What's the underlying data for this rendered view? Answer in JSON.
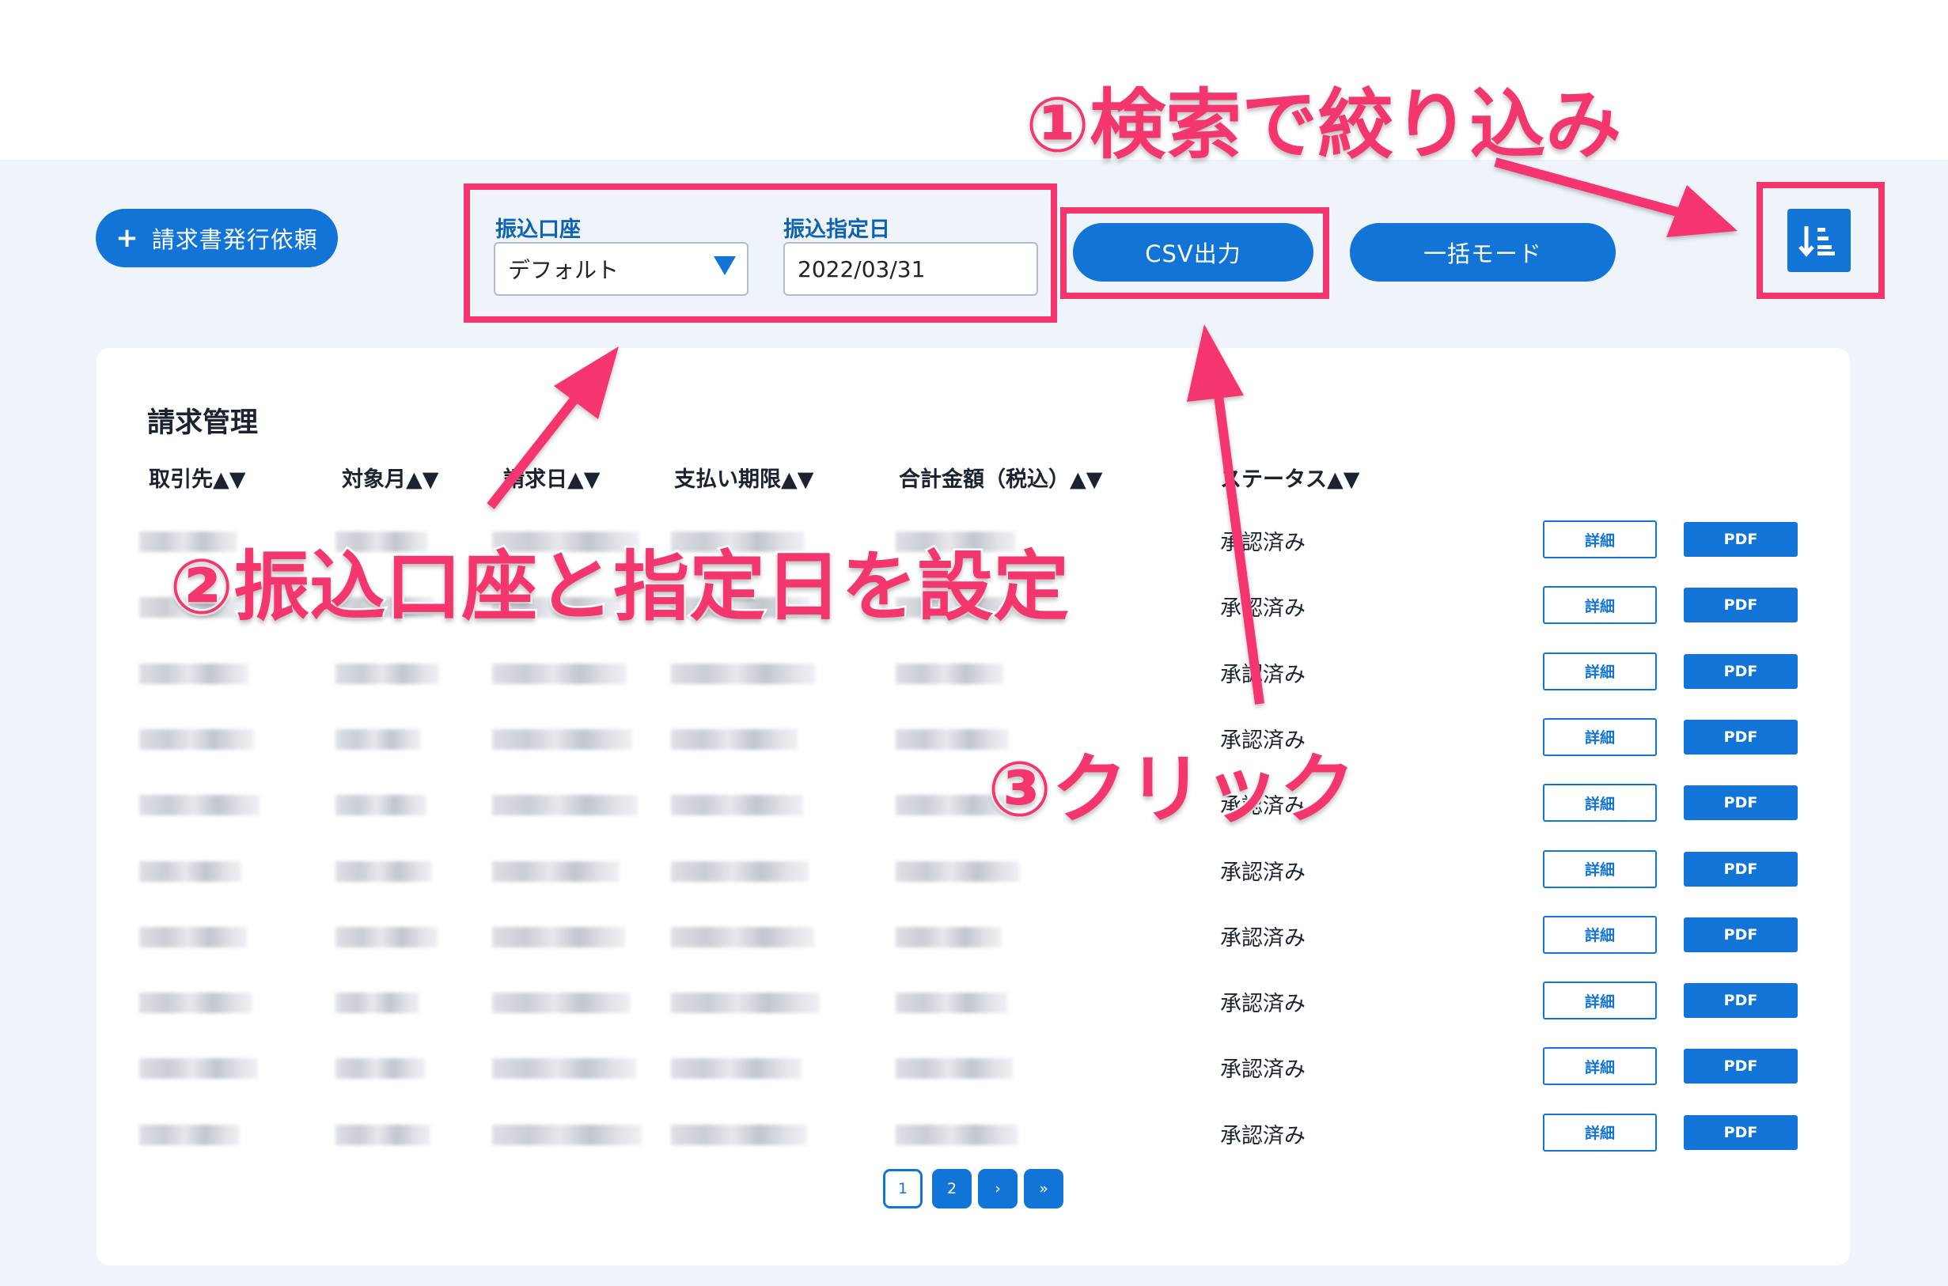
{
  "toolbar": {
    "add_invoice_label": "請求書発行依頼",
    "add_invoice_icon": "plus-icon",
    "transfer_account_label": "振込口座",
    "transfer_account_value": "デフォルト",
    "transfer_date_label": "振込指定日",
    "transfer_date_value": "2022/03/31",
    "csv_button_label": "CSV出力",
    "bulk_mode_label": "一括モード",
    "sort_icon": "sort-descending-icon"
  },
  "table": {
    "title": "請求管理",
    "columns": [
      "取引先▲▼",
      "対象月▲▼",
      "請求日▲▼",
      "支払い期限▲▼",
      "合計金額（税込）▲▼",
      "ステータス▲▼"
    ],
    "rows": [
      {
        "status": "承認済み",
        "detail": "詳細",
        "pdf": "PDF"
      },
      {
        "status": "承認済み",
        "detail": "詳細",
        "pdf": "PDF"
      },
      {
        "status": "承認済み",
        "detail": "詳細",
        "pdf": "PDF"
      },
      {
        "status": "承認済み",
        "detail": "詳細",
        "pdf": "PDF"
      },
      {
        "status": "承認済み",
        "detail": "詳細",
        "pdf": "PDF"
      },
      {
        "status": "承認済み",
        "detail": "詳細",
        "pdf": "PDF"
      },
      {
        "status": "承認済み",
        "detail": "詳細",
        "pdf": "PDF"
      },
      {
        "status": "承認済み",
        "detail": "詳細",
        "pdf": "PDF"
      },
      {
        "status": "承認済み",
        "detail": "詳細",
        "pdf": "PDF"
      },
      {
        "status": "承認済み",
        "detail": "詳細",
        "pdf": "PDF"
      }
    ]
  },
  "pagination": {
    "pages": [
      "1",
      "2"
    ],
    "next": "›",
    "last": "»"
  },
  "annotations": {
    "step1": "①検索で絞り込み",
    "step2": "②振込口座と指定日を設定",
    "step3": "③クリック",
    "color": "#f4366f"
  },
  "colors": {
    "primary": "#1174d6",
    "highlight": "#f4366f",
    "background": "#eef4fa"
  }
}
